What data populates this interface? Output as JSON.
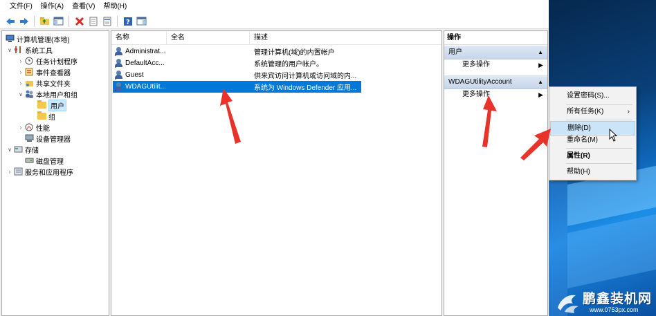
{
  "menubar": {
    "items": [
      "文件(F)",
      "操作(A)",
      "查看(V)",
      "帮助(H)"
    ]
  },
  "toolbar": {
    "icons": [
      "back-icon",
      "forward-icon",
      "up-folder-icon",
      "show-hide-tree-icon",
      "delete-icon",
      "properties-icon",
      "export-icon",
      "help-icon",
      "show-action-pane-icon"
    ]
  },
  "tree": {
    "root": "计算机管理(本地)",
    "system_tools": "系统工具",
    "task_scheduler": "任务计划程序",
    "event_viewer": "事件查看器",
    "shared_folders": "共享文件夹",
    "local_users_groups": "本地用户和组",
    "users": "用户",
    "groups": "组",
    "performance": "性能",
    "device_manager": "设备管理器",
    "storage": "存储",
    "disk_management": "磁盘管理",
    "services_apps": "服务和应用程序"
  },
  "list": {
    "headers": {
      "name": "名称",
      "fullname": "全名",
      "description": "描述"
    },
    "rows": [
      {
        "name": "Administrat...",
        "fullname": "",
        "description": "管理计算机(域)的内置帐户"
      },
      {
        "name": "DefaultAcc...",
        "fullname": "",
        "description": "系统管理的用户帐户。"
      },
      {
        "name": "Guest",
        "fullname": "",
        "description": "供来宾访问计算机或访问域的内..."
      },
      {
        "name": "WDAGUtilit...",
        "fullname": "",
        "description": "系统为 Windows Defender 应用..."
      }
    ]
  },
  "actions": {
    "title": "操作",
    "section1": "用户",
    "section1_more": "更多操作",
    "section2": "WDAGUtilityAccount",
    "section2_more": "更多操作"
  },
  "context_menu": {
    "set_password": "设置密码(S)...",
    "all_tasks": "所有任务(K)",
    "delete": "删除(D)",
    "rename": "重命名(M)",
    "properties": "属性(R)",
    "help": "帮助(H)"
  },
  "watermark": {
    "brand": "鹏鑫装机网",
    "url": "www.0753px.com"
  },
  "colors": {
    "selection": "#0078d7",
    "annotation_arrow": "#e8322a",
    "menu_hover": "#cce4f7"
  }
}
